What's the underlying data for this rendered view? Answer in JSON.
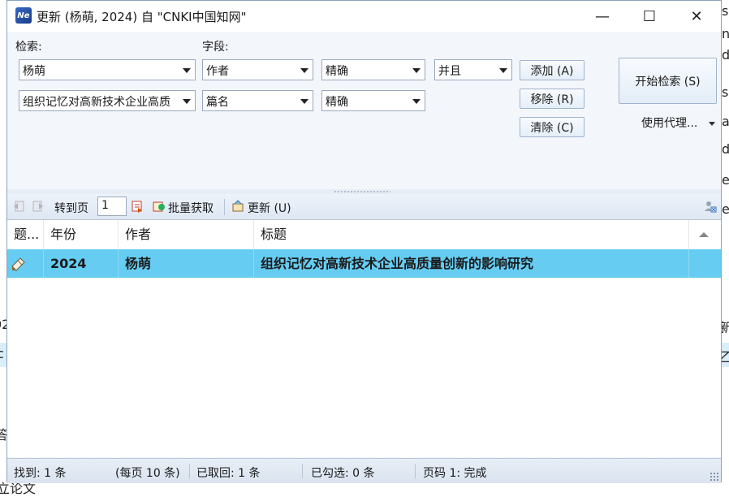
{
  "window": {
    "title": "更新 (杨萌, 2024) 自 \"CNKI中国知网\"",
    "icon_text": "Ne",
    "controls": {
      "minimize": "—",
      "maximize": "☐",
      "close": "✕"
    }
  },
  "form": {
    "search_label": "检索:",
    "field_label": "字段:",
    "rows": [
      {
        "term": "杨萌",
        "field": "作者",
        "match": "精确",
        "logic": "并且"
      },
      {
        "term": "组织记忆对高新技术企业高质",
        "field": "篇名",
        "match": "精确"
      }
    ],
    "add_button": "添加 (A)",
    "remove_button": "移除 (R)",
    "clear_button": "清除 (C)",
    "start_button": "开始检索 (S)",
    "proxy_label": "使用代理..."
  },
  "toolbar": {
    "goto_label": "转到页",
    "page_value": "1",
    "batch_label": "批量获取",
    "update_label": "更新 (U)"
  },
  "table": {
    "columns": [
      "题...",
      "年份",
      "作者",
      "标题"
    ],
    "rows": [
      {
        "year": "2024",
        "author": "杨萌",
        "title": "组织记忆对高新技术企业高质量创新的影响研究"
      }
    ]
  },
  "status": {
    "found": "找到: 1 条",
    "per_page": "(每页 10 条)",
    "retrieved": "已取回: 1 条",
    "checked": "已勾选: 0 条",
    "page": "页码 1: 完成"
  },
  "background": {
    "right_fragments": [
      "s",
      "n",
      "di",
      "s",
      "a",
      "di",
      "e",
      "e",
      "新",
      "乙"
    ],
    "left_fragments": [
      "02",
      "c",
      "答",
      "立论文"
    ]
  }
}
